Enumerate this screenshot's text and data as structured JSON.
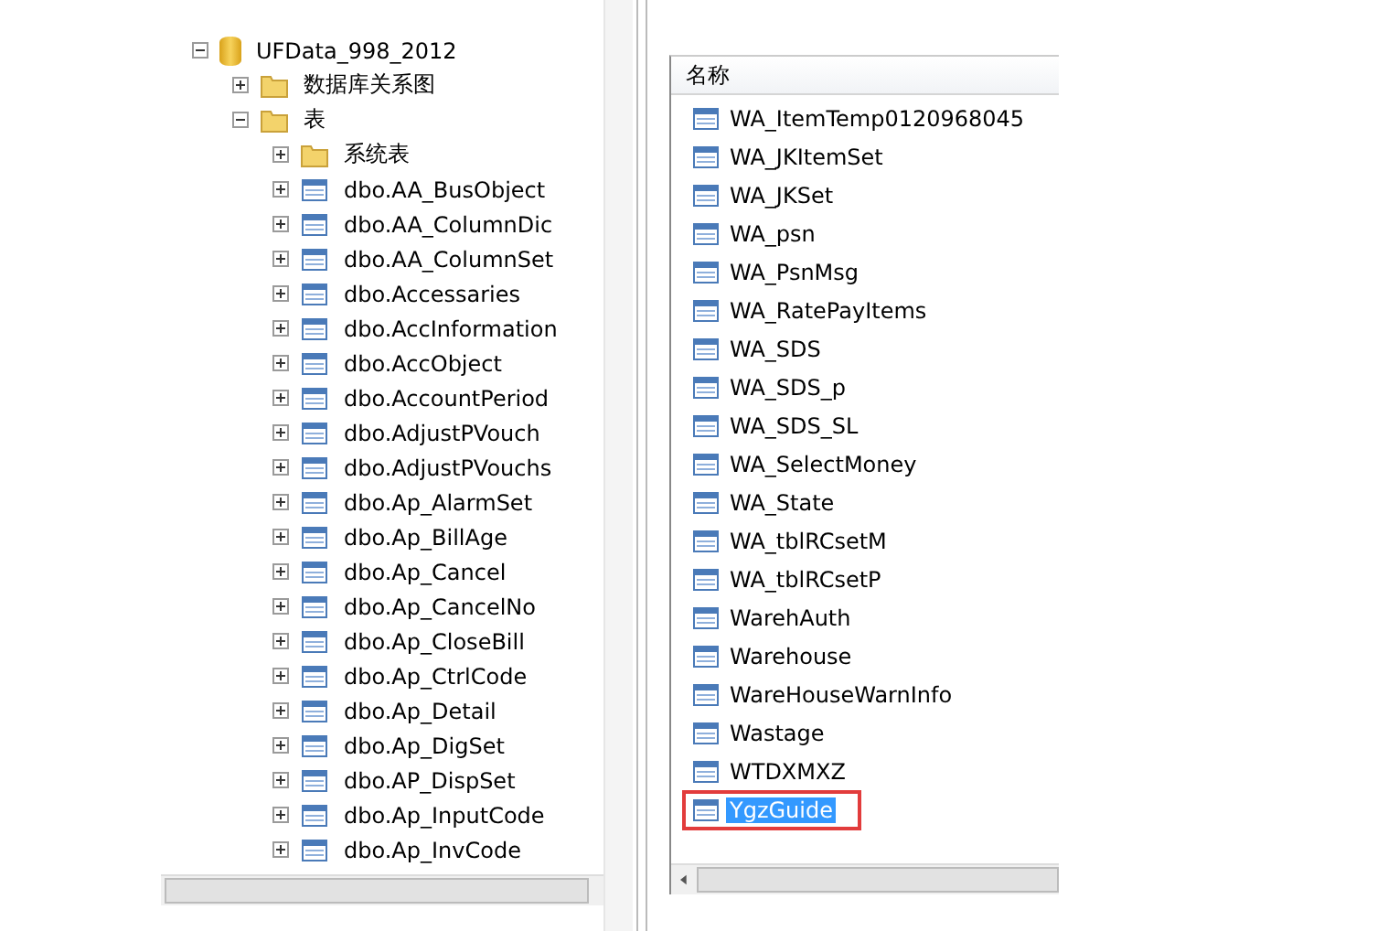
{
  "tree": [
    {
      "label": "UFData_998_2012",
      "kind": "database",
      "expanded": true,
      "children": [
        {
          "label": "数据库关系图",
          "kind": "folder",
          "expanded": false
        },
        {
          "label": "表",
          "kind": "folder",
          "expanded": true,
          "children": [
            {
              "label": "系统表",
              "kind": "folder",
              "expanded": false
            },
            {
              "label": "dbo.AA_BusObject",
              "kind": "table",
              "expanded": false
            },
            {
              "label": "dbo.AA_ColumnDic",
              "kind": "table",
              "expanded": false
            },
            {
              "label": "dbo.AA_ColumnSet",
              "kind": "table",
              "expanded": false
            },
            {
              "label": "dbo.Accessaries",
              "kind": "table",
              "expanded": false
            },
            {
              "label": "dbo.AccInformation",
              "kind": "table",
              "expanded": false
            },
            {
              "label": "dbo.AccObject",
              "kind": "table",
              "expanded": false
            },
            {
              "label": "dbo.AccountPeriod",
              "kind": "table",
              "expanded": false
            },
            {
              "label": "dbo.AdjustPVouch",
              "kind": "table",
              "expanded": false
            },
            {
              "label": "dbo.AdjustPVouchs",
              "kind": "table",
              "expanded": false
            },
            {
              "label": "dbo.Ap_AlarmSet",
              "kind": "table",
              "expanded": false
            },
            {
              "label": "dbo.Ap_BillAge",
              "kind": "table",
              "expanded": false
            },
            {
              "label": "dbo.Ap_Cancel",
              "kind": "table",
              "expanded": false
            },
            {
              "label": "dbo.Ap_CancelNo",
              "kind": "table",
              "expanded": false
            },
            {
              "label": "dbo.Ap_CloseBill",
              "kind": "table",
              "expanded": false
            },
            {
              "label": "dbo.Ap_CtrlCode",
              "kind": "table",
              "expanded": false
            },
            {
              "label": "dbo.Ap_Detail",
              "kind": "table",
              "expanded": false
            },
            {
              "label": "dbo.Ap_DigSet",
              "kind": "table",
              "expanded": false
            },
            {
              "label": "dbo.AP_DispSet",
              "kind": "table",
              "expanded": false
            },
            {
              "label": "dbo.Ap_InputCode",
              "kind": "table",
              "expanded": false
            },
            {
              "label": "dbo.Ap_InvCode",
              "kind": "table",
              "expanded": false
            }
          ]
        }
      ]
    }
  ],
  "list": {
    "column": "名称",
    "items": [
      {
        "name": "WA_ItemTemp0120968045",
        "selected": false,
        "annotated": false
      },
      {
        "name": "WA_JKItemSet",
        "selected": false,
        "annotated": false
      },
      {
        "name": "WA_JKSet",
        "selected": false,
        "annotated": false
      },
      {
        "name": "WA_psn",
        "selected": false,
        "annotated": false
      },
      {
        "name": "WA_PsnMsg",
        "selected": false,
        "annotated": false
      },
      {
        "name": "WA_RatePayItems",
        "selected": false,
        "annotated": false
      },
      {
        "name": "WA_SDS",
        "selected": false,
        "annotated": false
      },
      {
        "name": "WA_SDS_p",
        "selected": false,
        "annotated": false
      },
      {
        "name": "WA_SDS_SL",
        "selected": false,
        "annotated": false
      },
      {
        "name": "WA_SelectMoney",
        "selected": false,
        "annotated": false
      },
      {
        "name": "WA_State",
        "selected": false,
        "annotated": false
      },
      {
        "name": "WA_tblRCsetM",
        "selected": false,
        "annotated": false
      },
      {
        "name": "WA_tblRCsetP",
        "selected": false,
        "annotated": false
      },
      {
        "name": "WarehAuth",
        "selected": false,
        "annotated": false
      },
      {
        "name": "Warehouse",
        "selected": false,
        "annotated": false
      },
      {
        "name": "WareHouseWarnInfo",
        "selected": false,
        "annotated": false
      },
      {
        "name": "Wastage",
        "selected": false,
        "annotated": false
      },
      {
        "name": "WTDXMXZ",
        "selected": false,
        "annotated": false
      },
      {
        "name": "YgzGuide",
        "selected": true,
        "annotated": true
      }
    ]
  }
}
